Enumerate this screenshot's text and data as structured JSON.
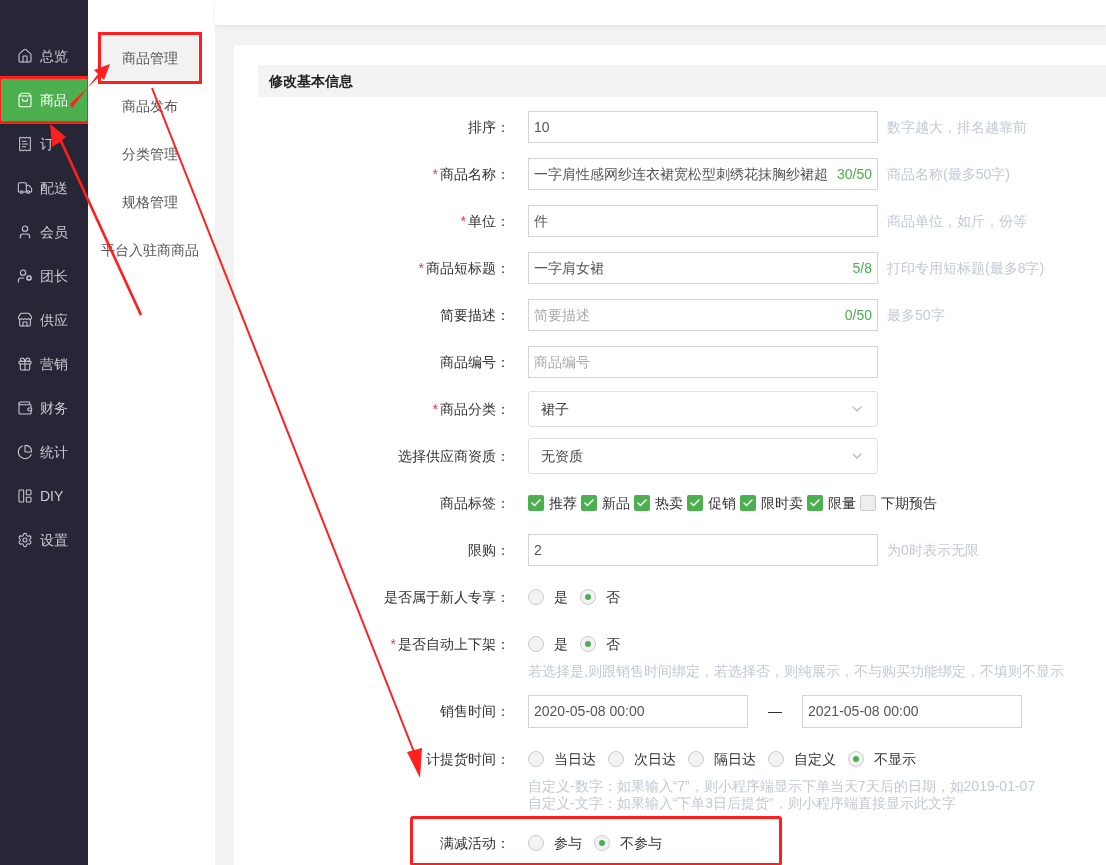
{
  "sidebar": {
    "items": [
      {
        "label": "总览",
        "selected": false
      },
      {
        "label": "商品",
        "selected": true
      },
      {
        "label": "订",
        "selected": false
      },
      {
        "label": "配送",
        "selected": false
      },
      {
        "label": "会员",
        "selected": false
      },
      {
        "label": "团长",
        "selected": false
      },
      {
        "label": "供应",
        "selected": false
      },
      {
        "label": "营销",
        "selected": false
      },
      {
        "label": "财务",
        "selected": false
      },
      {
        "label": "统计",
        "selected": false
      },
      {
        "label": "DIY",
        "selected": false
      },
      {
        "label": "设置",
        "selected": false
      }
    ]
  },
  "submenu": {
    "items": [
      {
        "label": "商品管理",
        "selected": true
      },
      {
        "label": "商品发布",
        "selected": false
      },
      {
        "label": "分类管理",
        "selected": false
      },
      {
        "label": "规格管理",
        "selected": false
      },
      {
        "label": "平台入驻商商品",
        "selected": false
      }
    ]
  },
  "form": {
    "title": "修改基本信息",
    "rows": [
      {
        "kind": "text",
        "label": "排序：",
        "required": false,
        "value": "10",
        "hint": "数字越大，排名越靠前"
      },
      {
        "kind": "text",
        "label": "商品名称：",
        "required": "*",
        "value": "一字肩性感网纱连衣裙宽松型刺绣花抹胸纱裙超",
        "counter": "30/50",
        "hint": "商品名称(最多50字)"
      },
      {
        "kind": "text",
        "label": "单位：",
        "required": "*",
        "value": "件",
        "hint": "商品单位，如斤，份等"
      },
      {
        "kind": "text",
        "label": "商品短标题：",
        "required": "*",
        "value": "一字肩女裙",
        "counter": "5/8",
        "hint": "打印专用短标题(最多8字)"
      },
      {
        "kind": "text",
        "label": "简要描述：",
        "required": false,
        "placeholder": "简要描述",
        "counter": "0/50",
        "hint": "最多50字"
      },
      {
        "kind": "text",
        "label": "商品编号：",
        "required": false,
        "placeholder": "商品编号"
      },
      {
        "kind": "select",
        "label": "商品分类：",
        "required": "*",
        "value": "裙子"
      },
      {
        "kind": "select",
        "label": "选择供应商资质：",
        "required": false,
        "value": "无资质"
      },
      {
        "kind": "checkboxes",
        "label": "商品标签：",
        "required": false,
        "options": [
          {
            "label": "推荐",
            "checked": true
          },
          {
            "label": "新品",
            "checked": true
          },
          {
            "label": "热卖",
            "checked": true
          },
          {
            "label": "促销",
            "checked": true
          },
          {
            "label": "限时卖",
            "checked": true
          },
          {
            "label": "限量",
            "checked": true
          },
          {
            "label": "下期预告",
            "checked": false
          }
        ]
      },
      {
        "kind": "text",
        "label": "限购：",
        "required": false,
        "value": "2",
        "hint": "为0时表示无限"
      },
      {
        "kind": "radios",
        "label": "是否属于新人专享：",
        "required": false,
        "options": [
          {
            "label": "是",
            "selected": false
          },
          {
            "label": "否",
            "selected": true
          }
        ]
      },
      {
        "kind": "radios",
        "label": "是否自动上下架：",
        "required": "*",
        "options": [
          {
            "label": "是",
            "selected": false
          },
          {
            "label": "否",
            "selected": true
          }
        ],
        "notes": [
          "若选择是,则跟销售时间绑定，若选择否，则纯展示，不与购买功能绑定，不填则不显示"
        ]
      },
      {
        "kind": "daterange",
        "label": "销售时间：",
        "required": false,
        "start": "2020-05-08 00:00",
        "separator": "—",
        "end": "2021-05-08 00:00"
      },
      {
        "kind": "radios",
        "label": "计提货时间：",
        "required": false,
        "options": [
          {
            "label": "当日达",
            "selected": false
          },
          {
            "label": "次日达",
            "selected": false
          },
          {
            "label": "隔日达",
            "selected": false
          },
          {
            "label": "自定义",
            "selected": false
          },
          {
            "label": "不显示",
            "selected": true
          }
        ],
        "notes": [
          "自定义-数字：如果输入“7”，则小程序端显示下单当天7天后的日期，如2019-01-07",
          "自定义-文字：如果输入“下单3日后提货”，则小程序端直接显示此文字"
        ]
      },
      {
        "kind": "radios",
        "label": "满减活动：",
        "required": false,
        "options": [
          {
            "label": "参与",
            "selected": false
          },
          {
            "label": "不参与",
            "selected": true
          }
        ]
      }
    ]
  }
}
